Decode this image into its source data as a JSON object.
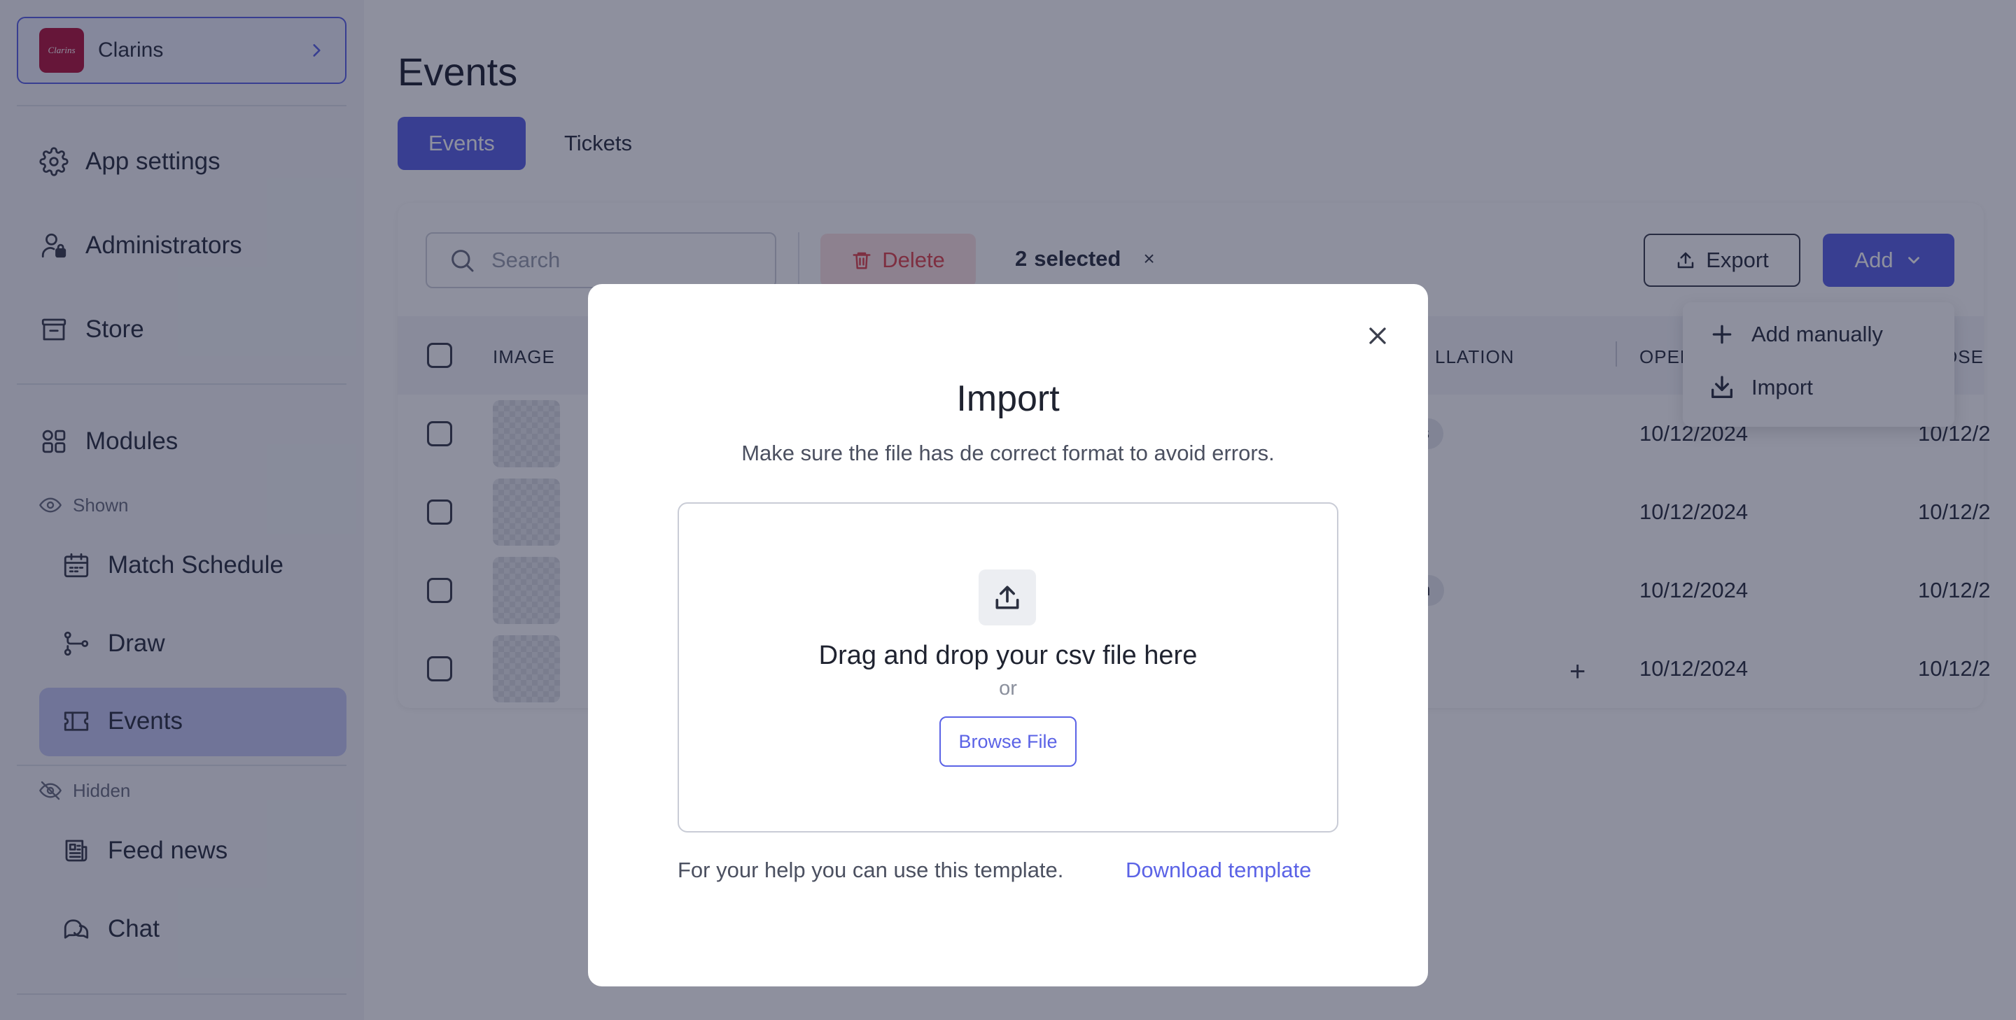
{
  "sidebar": {
    "app_name": "Clarins",
    "logo_text": "Clarins",
    "items": {
      "app_settings": "App settings",
      "administrators": "Administrators",
      "store": "Store",
      "modules": "Modules"
    },
    "shown_label": "Shown",
    "shown_items": {
      "match_schedule": "Match Schedule",
      "draw": "Draw",
      "events": "Events"
    },
    "hidden_label": "Hidden",
    "hidden_items": {
      "feed_news": "Feed news",
      "chat": "Chat"
    }
  },
  "main": {
    "title": "Events",
    "tabs": {
      "events": "Events",
      "tickets": "Tickets"
    },
    "toolbar": {
      "search_placeholder": "Search",
      "delete_label": "Delete",
      "selected_count": "2",
      "selected_suffix": "selected",
      "clear_selection": "×",
      "export_label": "Export",
      "add_label": "Add"
    },
    "add_menu": {
      "manual": "Add manually",
      "import": "Import"
    },
    "table": {
      "headers": {
        "image": "IMAGE",
        "installation": "LLATION",
        "open": "OPEN",
        "close": "OSE"
      },
      "rows": [
        {
          "chip": "s",
          "open": "10/12/2024",
          "close": "10/12/2"
        },
        {
          "chip": "",
          "open": "10/12/2024",
          "close": "10/12/2"
        },
        {
          "chip": "n",
          "open": "10/12/2024",
          "close": "10/12/2"
        },
        {
          "chip": "",
          "open": "10/12/2024",
          "close": "10/12/2"
        }
      ],
      "add_cell": "+"
    }
  },
  "modal": {
    "title": "Import",
    "subtitle": "Make sure the file has de correct format to avoid errors.",
    "dropzone_text": "Drag and drop your csv file here",
    "or_text": "or",
    "browse_label": "Browse File",
    "help_text": "For your help you can use this template.",
    "download_label": "Download template"
  },
  "colors": {
    "accent": "#5b63e6",
    "danger": "#e0464e",
    "brand_logo": "#b3163e"
  }
}
